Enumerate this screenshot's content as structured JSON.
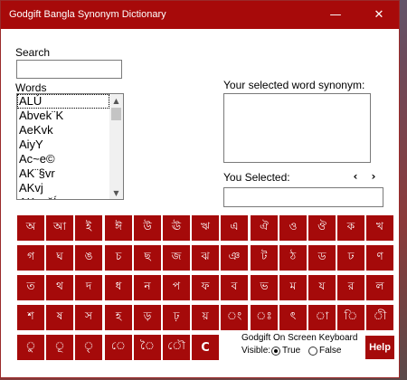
{
  "window": {
    "title": "Godgift Bangla Synonym Dictionary"
  },
  "titlebar": {
    "minimize_icon": "minimize-icon",
    "close_icon": "close-icon",
    "minimize_glyph": "—",
    "close_glyph": "✕"
  },
  "search": {
    "label": "Search",
    "value": ""
  },
  "words": {
    "label": "Words",
    "items": [
      "ALÚ",
      "Abvek¨K",
      "AeKvk",
      "AiyY",
      "Ac~e©",
      "AK¨§vr",
      "AKvj",
      "AK¬všÍ"
    ]
  },
  "synonym": {
    "label": "Your selected word synonym:",
    "value": ""
  },
  "selected": {
    "label": "You Selected:",
    "value": "",
    "prev": "‹",
    "next": "›"
  },
  "keyboard": {
    "rows": [
      [
        "অ",
        "আ",
        "ই",
        "ঈ",
        "উ",
        "ঊ",
        "ঋ",
        "এ",
        "ঐ",
        "ও",
        "ঔ",
        "ক",
        "খ"
      ],
      [
        "গ",
        "ঘ",
        "ঙ",
        "চ",
        "ছ",
        "জ",
        "ঝ",
        "ঞ",
        "ট",
        "ঠ",
        "ড",
        "ঢ",
        "ণ"
      ],
      [
        "ত",
        "থ",
        "দ",
        "ধ",
        "ন",
        "প",
        "ফ",
        "ব",
        "ভ",
        "ম",
        "য",
        "র",
        "ল"
      ],
      [
        "শ",
        "ষ",
        "স",
        "হ",
        "ড়",
        "ঢ়",
        "য়",
        "ং",
        "ঃ",
        "ৎ",
        "া",
        "ি",
        "ী"
      ],
      [
        "ু",
        "ূ",
        "ৃ",
        "ে",
        "ৈ",
        "ৌ",
        "C"
      ]
    ]
  },
  "osk": {
    "title": "Godgift On Screen Keyboard",
    "visible_label": "Visible:",
    "options": [
      "True",
      "False"
    ],
    "selected": "True"
  },
  "help": {
    "label": "Help"
  }
}
